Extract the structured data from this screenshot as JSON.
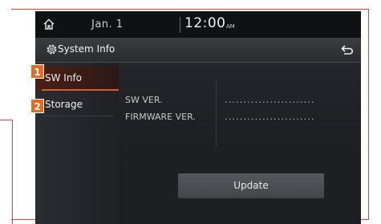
{
  "status_bar": {
    "date": "Jan.  1",
    "time": "12:00",
    "ampm": "AM"
  },
  "title_bar": {
    "title": "System Info"
  },
  "sidebar": {
    "items": [
      {
        "label": "SW Info",
        "badge": "1"
      },
      {
        "label": "Storage",
        "badge": "2"
      }
    ]
  },
  "info": {
    "rows": [
      {
        "label": "SW VER.",
        "value": "........................"
      },
      {
        "label": "FIRMWARE VER.",
        "value": "........................"
      }
    ]
  },
  "update_button": {
    "label": "Update"
  },
  "colors": {
    "accent": "#e86a21",
    "callout_line": "#e0443a"
  },
  "icons": [
    "home-icon",
    "gear-icon",
    "back-icon"
  ]
}
